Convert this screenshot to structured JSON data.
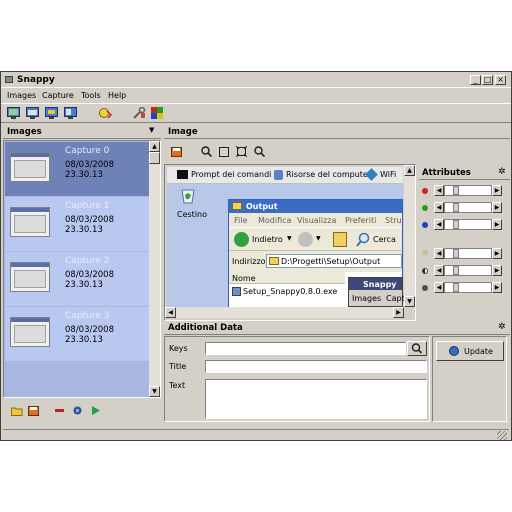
{
  "window": {
    "title": "Snappy"
  },
  "menu": [
    "Images",
    "Capture",
    "Tools",
    "Help"
  ],
  "left_panel": {
    "title": "Images",
    "captures": [
      {
        "name": "Capture 0",
        "date": "08/03/2008 23.30.13",
        "selected": true
      },
      {
        "name": "Capture 1",
        "date": "08/03/2008 23.30.13",
        "selected": false
      },
      {
        "name": "Capture 2",
        "date": "08/03/2008 23.30.13",
        "selected": false
      },
      {
        "name": "Capture 3",
        "date": "08/03/2008 23.30.13",
        "selected": false
      }
    ]
  },
  "image_panel": {
    "title": "Image",
    "preview": {
      "taskbar_items": [
        "Prompt dei comandi",
        "Risorse del computer",
        "WiFi"
      ],
      "desktop_icon": "Cestino",
      "explorer": {
        "title": "Output",
        "menu": [
          "File",
          "Modifica",
          "Visualizza",
          "Preferiti",
          "Stru"
        ],
        "back": "Indietro",
        "search": "Cerca",
        "address_label": "Indirizzo",
        "address": "D:\\Progetti\\Setup\\Output",
        "column": "Nome",
        "file": "Setup_Snappy0.8.0.exe"
      },
      "snappy_mini": {
        "title": "Snappy",
        "menu": [
          "Images",
          "Capt"
        ]
      }
    }
  },
  "attributes": {
    "title": "Attributes"
  },
  "additional": {
    "title": "Additional Data",
    "keys_label": "Keys",
    "title_label": "Title",
    "text_label": "Text",
    "update_label": "Update",
    "keys_value": "",
    "title_value": "",
    "text_value": ""
  },
  "colors": {
    "selected": "#6e82b8",
    "item_bg": "#b8c8f0",
    "accent": "#3b6cc4"
  }
}
